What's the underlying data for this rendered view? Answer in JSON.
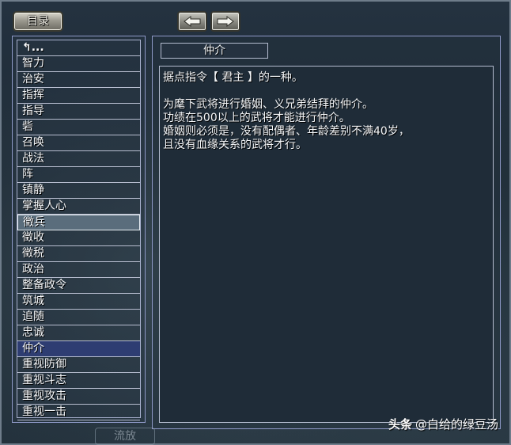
{
  "toolbar": {
    "menu_label": "目录",
    "prev_icon": "arrow-left-icon",
    "next_icon": "arrow-right-icon"
  },
  "list": {
    "items": [
      {
        "label": "↰..."
      },
      {
        "label": "智力"
      },
      {
        "label": "治安"
      },
      {
        "label": "指挥"
      },
      {
        "label": "指导"
      },
      {
        "label": "砦"
      },
      {
        "label": "召唤"
      },
      {
        "label": "战法"
      },
      {
        "label": "阵"
      },
      {
        "label": "镇静"
      },
      {
        "label": "掌握人心"
      },
      {
        "label": "徵兵"
      },
      {
        "label": "徵收"
      },
      {
        "label": "徵税"
      },
      {
        "label": "政治"
      },
      {
        "label": "整备政令"
      },
      {
        "label": "筑城"
      },
      {
        "label": "追随"
      },
      {
        "label": "忠诚"
      },
      {
        "label": "仲介"
      },
      {
        "label": "重视防御"
      },
      {
        "label": "重视斗志"
      },
      {
        "label": "重视攻击"
      },
      {
        "label": "重视一击"
      }
    ],
    "hover_index": 11,
    "selected_index": 19
  },
  "detail": {
    "title": "仲介",
    "lines": [
      "据点指令【 君主 】的一种。",
      "",
      "为麾下武将进行婚姻、义兄弟结拜的仲介。",
      "功绩在500以上的武将才能进行仲介。",
      "婚姻则必须是，没有配偶者、年龄差别不满40岁，",
      "且没有血缘关系的武将才行。"
    ]
  },
  "bottom": {
    "button_label": "流放"
  },
  "watermark": {
    "brand": "头条",
    "handle": "@白给的绿豆汤"
  }
}
